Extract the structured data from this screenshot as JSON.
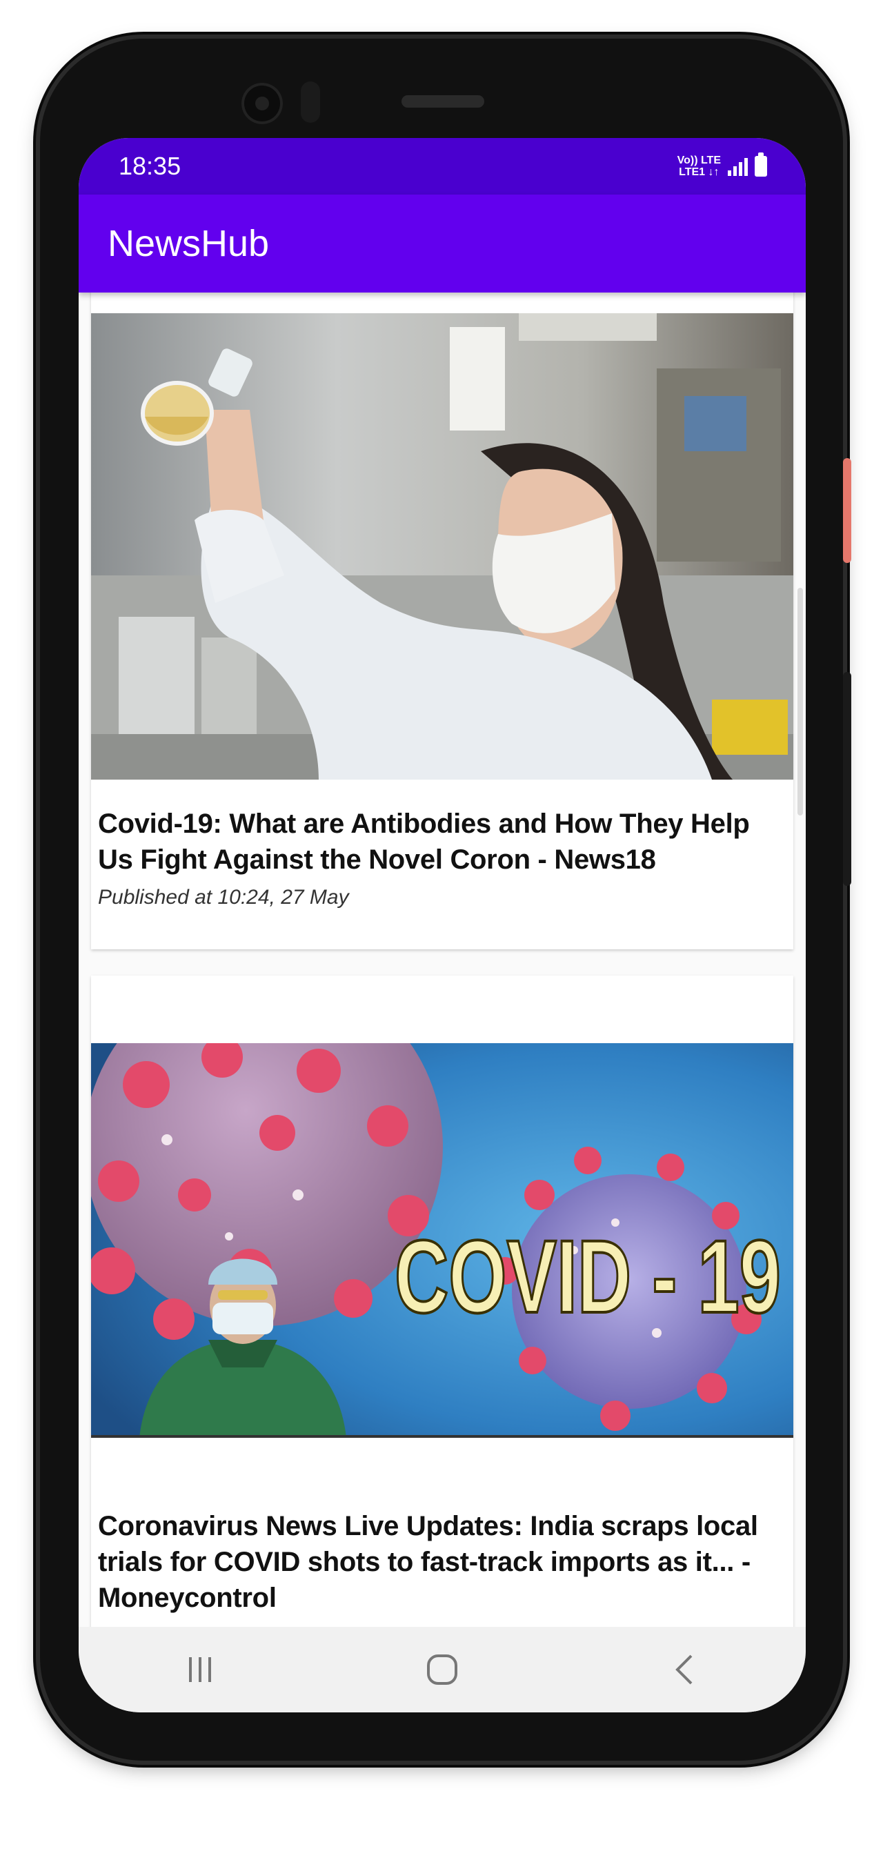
{
  "status_bar": {
    "time": "18:35",
    "network_line1": "Vo)) LTE",
    "network_line2": "LTE1 ↓↑",
    "icons": [
      "volte-icon",
      "lte-icon",
      "signal-icon",
      "battery-icon"
    ]
  },
  "app_bar": {
    "title": "NewsHub",
    "color": "#6200ee",
    "status_color": "#4a00cf"
  },
  "articles": [
    {
      "headline": "Covid-19: What are Antibodies and How They Help Us Fight Against the Novel Coron - News18",
      "published": "Published at 10:24, 27 May",
      "image": "scientist-with-flask-photo"
    },
    {
      "headline": "Coronavirus News Live Updates: India scraps local trials for COVID shots to fast-track imports as it... - Moneycontrol",
      "published": "",
      "image": "covid-19-virus-banner",
      "image_text": "COVID - 19"
    }
  ],
  "nav_bar": {
    "buttons": [
      "recents-icon",
      "home-icon",
      "back-icon"
    ]
  }
}
